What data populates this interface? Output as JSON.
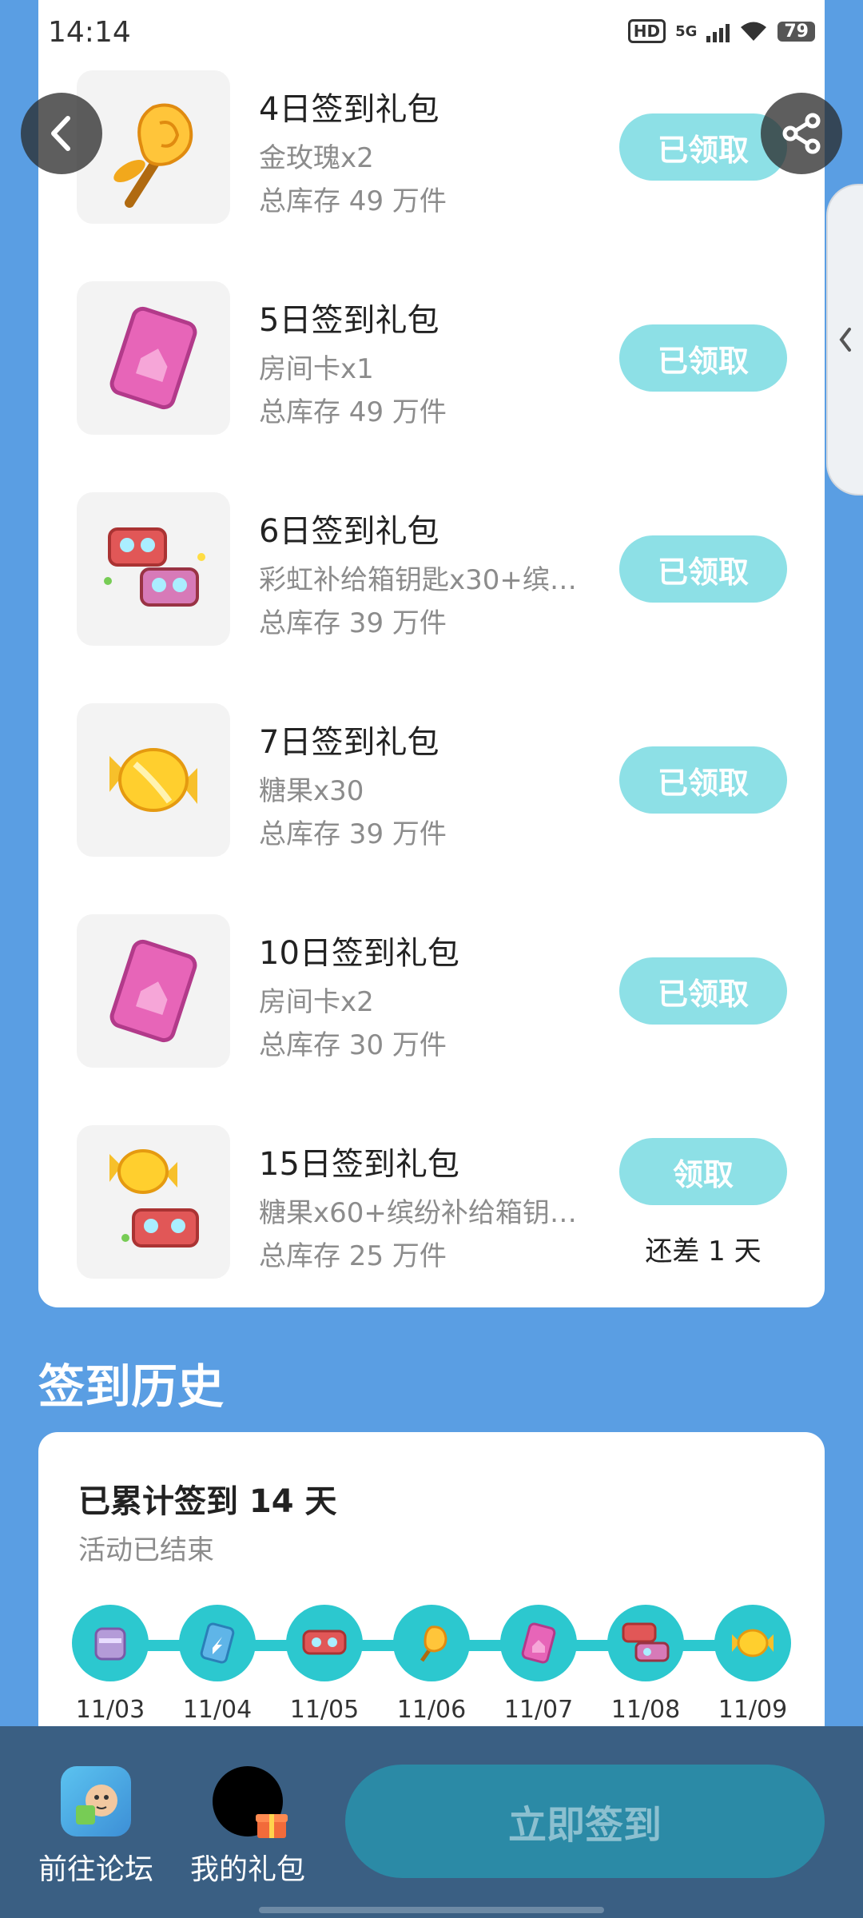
{
  "status": {
    "time": "14:14",
    "hd": "HD",
    "network": "5G",
    "battery": "79"
  },
  "rewards": [
    {
      "title": "4日签到礼包",
      "desc": "金玫瑰x2",
      "stock": "总库存 49 万件",
      "button": "已领取",
      "icon": "gold-rose-icon"
    },
    {
      "title": "5日签到礼包",
      "desc": "房间卡x1",
      "stock": "总库存 49 万件",
      "button": "已领取",
      "icon": "room-card-icon"
    },
    {
      "title": "6日签到礼包",
      "desc": "彩虹补给箱钥匙x30+缤…",
      "stock": "总库存 39 万件",
      "button": "已领取",
      "icon": "supply-keys-icon"
    },
    {
      "title": "7日签到礼包",
      "desc": "糖果x30",
      "stock": "总库存 39 万件",
      "button": "已领取",
      "icon": "candy-icon"
    },
    {
      "title": "10日签到礼包",
      "desc": "房间卡x2",
      "stock": "总库存 30 万件",
      "button": "已领取",
      "icon": "room-card-icon"
    },
    {
      "title": "15日签到礼包",
      "desc": "糖果x60+缤纷补给箱钥…",
      "stock": "总库存 25 万件",
      "button": "领取",
      "note": "还差 1 天",
      "icon": "candy-keys-icon"
    }
  ],
  "history": {
    "section_title": "签到历史",
    "total": "已累计签到 14 天",
    "status": "活动已结束",
    "days": [
      {
        "date": "11/03",
        "icon": "chest-icon"
      },
      {
        "date": "11/04",
        "icon": "card-icon"
      },
      {
        "date": "11/05",
        "icon": "keys-icon"
      },
      {
        "date": "11/06",
        "icon": "gold-rose-icon"
      },
      {
        "date": "11/07",
        "icon": "room-card-icon"
      },
      {
        "date": "11/08",
        "icon": "keys-icon"
      },
      {
        "date": "11/09",
        "icon": "candy-icon"
      }
    ]
  },
  "bottom": {
    "forum": "前往论坛",
    "gifts": "我的礼包",
    "sign_button": "立即签到"
  },
  "colors": {
    "background": "#5a9ee3",
    "accent": "#2cc8cf",
    "claimed_button": "#8de0e6",
    "bottom_bar": "#3a5f83"
  }
}
